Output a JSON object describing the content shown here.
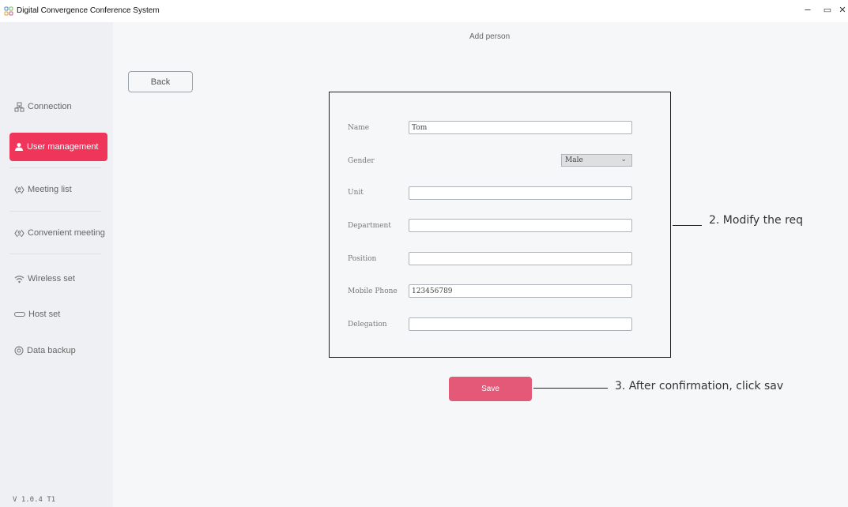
{
  "window": {
    "title": "Digital Convergence Conference System",
    "controls": {
      "minimize": "–",
      "restore": "▭",
      "close": "✕"
    }
  },
  "sidebar": {
    "items": [
      {
        "label": "Connection",
        "icon": "connection-icon"
      },
      {
        "label": "User management",
        "icon": "user-icon",
        "active": true
      },
      {
        "label": "Meeting list",
        "icon": "meeting-icon"
      },
      {
        "label": "Convenient meeting",
        "icon": "meeting-icon"
      },
      {
        "label": "Wireless set",
        "icon": "wifi-icon"
      },
      {
        "label": "Host set",
        "icon": "host-icon"
      },
      {
        "label": "Data backup",
        "icon": "backup-icon"
      }
    ],
    "version": "V 1.0.4 T1"
  },
  "page": {
    "title": "Add person",
    "back_label": "Back",
    "save_label": "Save"
  },
  "form": {
    "name": {
      "label": "Name",
      "value": "Tom"
    },
    "gender": {
      "label": "Gender",
      "value": "Male"
    },
    "unit": {
      "label": "Unit",
      "value": ""
    },
    "department": {
      "label": "Department",
      "value": ""
    },
    "position": {
      "label": "Position",
      "value": ""
    },
    "mobile": {
      "label": "Mobile Phone",
      "value": "123456789"
    },
    "delegation": {
      "label": "Delegation",
      "value": ""
    }
  },
  "annotations": {
    "step2": "2. Modify the req",
    "step3": "3. After confirmation, click sav"
  },
  "colors": {
    "accent": "#f0355a",
    "save_button": "#e45878"
  }
}
